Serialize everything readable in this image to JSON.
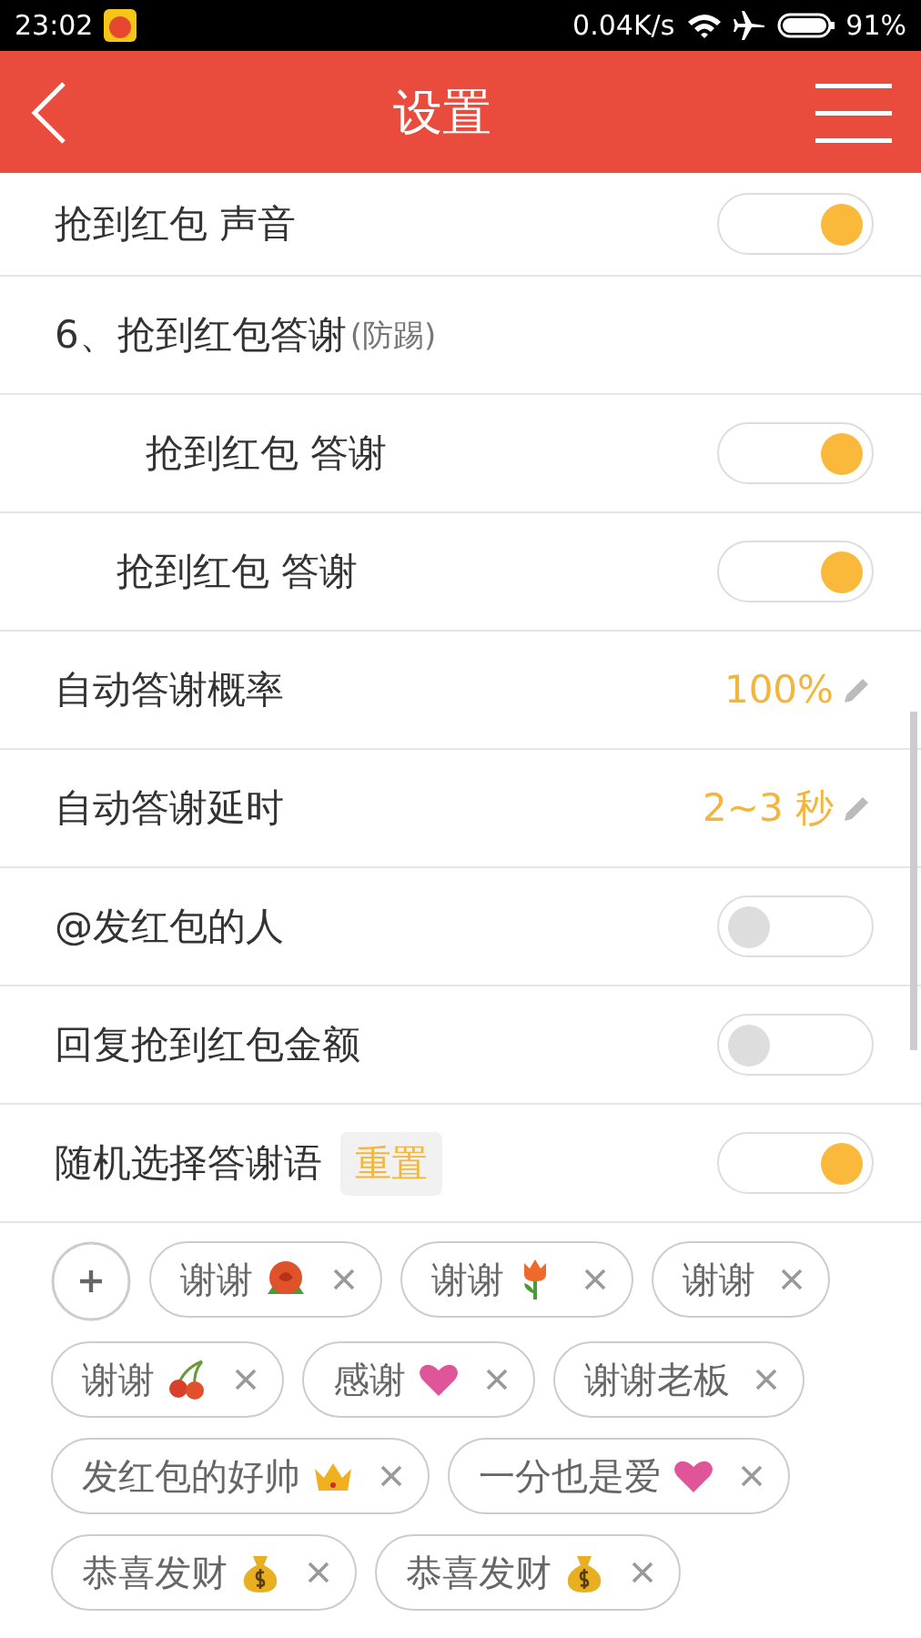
{
  "status_bar": {
    "time": "23:02",
    "speed": "0.04K/s",
    "battery": "91%"
  },
  "header": {
    "title": "设置"
  },
  "rows": [
    {
      "kind": "toggle",
      "label": "抢到红包 声音",
      "on": true
    },
    {
      "kind": "section",
      "label": "6、抢到红包答谢",
      "note": "(防踢)",
      "children": [
        {
          "kind": "toggle",
          "label": "抢到红包 答谢",
          "on": true
        },
        {
          "kind": "toggle",
          "label": "抢到红包 答谢",
          "on": true
        }
      ]
    },
    {
      "kind": "value",
      "label": "自动答谢概率",
      "value": "100%"
    },
    {
      "kind": "value",
      "label": "自动答谢延时",
      "value": "2~3 秒"
    },
    {
      "kind": "toggle",
      "label": "@发红包的人",
      "on": false
    },
    {
      "kind": "toggle",
      "label": "回复抢到红包金额",
      "on": false
    },
    {
      "kind": "toggle",
      "label": "随机选择答谢语",
      "button": "重置",
      "on": true
    }
  ],
  "tags": [
    {
      "label": "谢谢",
      "kind": "rose"
    },
    {
      "label": "谢谢",
      "kind": "tulip"
    },
    {
      "label": "谢谢",
      "kind": "plain"
    },
    {
      "label": "谢谢",
      "kind": "cherry"
    },
    {
      "label": "感谢",
      "kind": "heart"
    },
    {
      "label": "谢谢老板",
      "kind": "plain"
    },
    {
      "label": "发红包的好帅",
      "kind": "crown"
    },
    {
      "label": "一分也是爱",
      "kind": "heart"
    },
    {
      "label": "恭喜发财",
      "kind": "money"
    },
    {
      "label": "恭喜发财",
      "kind": "money"
    }
  ]
}
